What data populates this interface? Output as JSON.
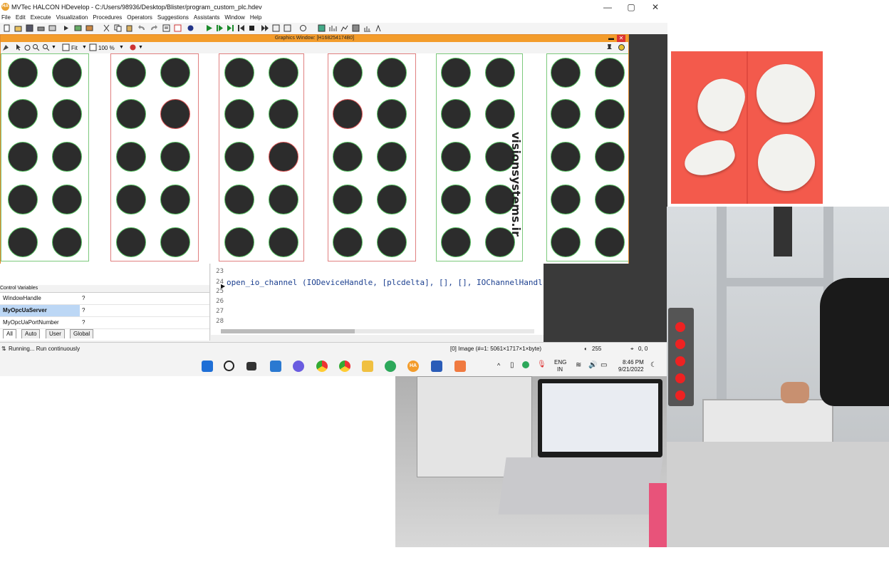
{
  "window": {
    "title": "MVTec HALCON HDevelop - C:/Users/98936/Desktop/Blister/program_custom_plc.hdev",
    "app_icon": "HA",
    "controls": [
      "—",
      "▢",
      "✕"
    ]
  },
  "menu": [
    "File",
    "Edit",
    "Execute",
    "Visualization",
    "Procedures",
    "Operators",
    "Suggestions",
    "Assistants",
    "Window",
    "Help"
  ],
  "graphics_window": {
    "title": "Graphics Window: [H168254174B0]",
    "fit_label": "Fit",
    "zoom_label": "100 %",
    "watermark": "visionsystems.ir"
  },
  "variables": {
    "header": "Control Variables",
    "rows": [
      {
        "name": "WindowHandle",
        "value": "?"
      },
      {
        "name": "MyOpcUaServer",
        "value": "?"
      },
      {
        "name": "MyOpcUaPortNumber",
        "value": "?"
      }
    ],
    "tabs": [
      "All",
      "Auto",
      "User",
      "Global"
    ]
  },
  "code": {
    "line_numbers": [
      "23",
      "24",
      "25",
      "26",
      "27",
      "28"
    ],
    "line_24": "open_io_channel (IODeviceHandle, [plcdelta], [], [], IOChannelHandl"
  },
  "status": {
    "left": "Running... Run continuously",
    "image": "[0] Image (#=1: 5061×1717×1×byte)",
    "value": "255",
    "coords": "0, 0"
  },
  "taskbar": {
    "lang_top": "ENG",
    "lang_bottom": "IN",
    "time": "8:46 PM",
    "date": "9/21/2022"
  },
  "colors": {
    "halcon_orange": "#f39c2b",
    "ok_green": "#55c060",
    "bad_red": "#d55555",
    "pill_bg": "#f35a4c"
  }
}
